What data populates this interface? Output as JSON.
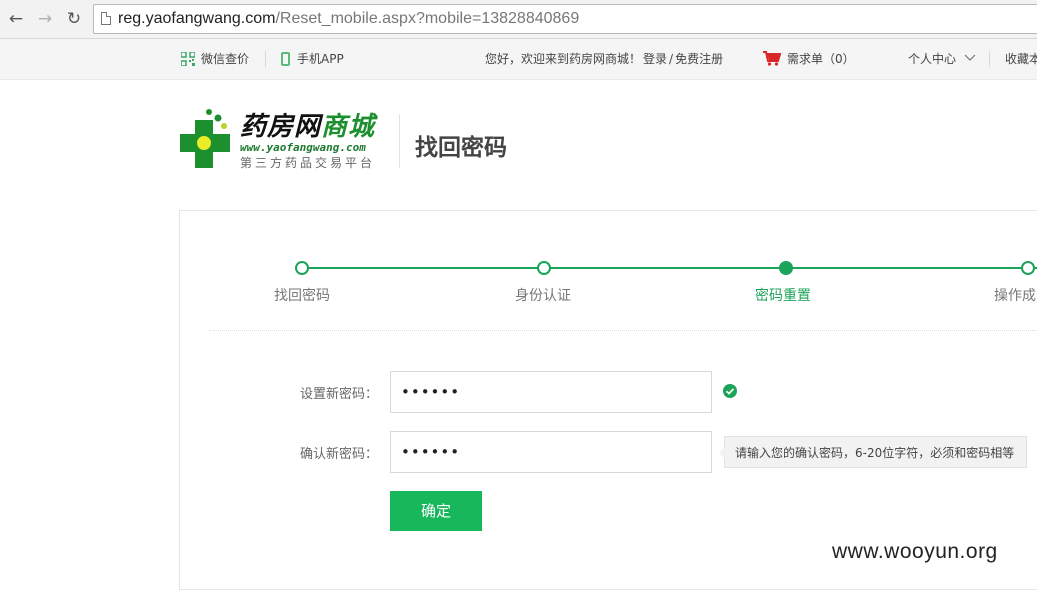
{
  "browser": {
    "url_host": "reg.yaofangwang.com",
    "url_path": "/Reset_mobile.aspx?mobile=13828840869",
    "back_icon": "back-arrow-icon",
    "forward_icon": "forward-arrow-icon",
    "reload_icon": "reload-icon"
  },
  "top_bar": {
    "wechat_price": "微信查价",
    "mobile_app": "手机APP",
    "welcome": "您好，欢迎来到药房网商城！",
    "login": "登录",
    "separator": "/",
    "register": "免费注册",
    "cart": "需求单（0）",
    "user_center": "个人中心",
    "favorites": "收藏本"
  },
  "header": {
    "logo_name_part1": "药房网",
    "logo_name_part2": "商城",
    "logo_url": "www.yaofangwang.com",
    "logo_slogan": "第三方药品交易平台",
    "page_title": "找回密码"
  },
  "steps": [
    {
      "label": "找回密码",
      "state": "done"
    },
    {
      "label": "身份认证",
      "state": "done"
    },
    {
      "label": "密码重置",
      "state": "current"
    },
    {
      "label": "操作成",
      "state": "pending"
    }
  ],
  "form": {
    "new_password_label": "设置新密码：",
    "new_password_value": "••••••",
    "confirm_password_label": "确认新密码：",
    "confirm_password_value": "••••••",
    "confirm_tip": "请输入您的确认密码，6-20位字符，必须和密码相等",
    "submit_label": "确定"
  },
  "watermark": "www.wooyun.org",
  "colors": {
    "accent": "#1ca35a",
    "button": "#18b75c",
    "cart": "#d92626"
  }
}
